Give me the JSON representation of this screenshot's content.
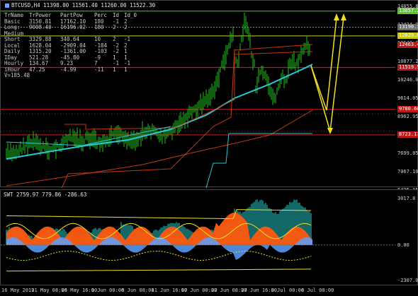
{
  "main": {
    "title": "BTCUSD,H4  11398.00 11561.40 11260.00 11522.30",
    "stats": {
      "headers": [
        "TrName",
        "TrPower",
        "PartPow",
        "Perc",
        "Id",
        "Id_0"
      ],
      "rows": [
        [
          "Basic",
          "3150.81",
          "17162.10",
          "180",
          "-1",
          "2"
        ],
        [
          "Long:",
          "9008.40",
          "16196.02",
          "180",
          "2",
          "2"
        ],
        [
          "Medium",
          "",
          "",
          "",
          "",
          ""
        ],
        [
          "Short",
          "3329.88",
          "340.64",
          "10",
          "2",
          "-1"
        ],
        [
          "Local",
          "1628.04",
          "-2909.04",
          "-184",
          "-2",
          "2"
        ],
        [
          "Daily",
          "1315.20",
          "-1361.00",
          "-103",
          "-2",
          "1"
        ],
        [
          "IDay",
          "521.28",
          "-45.80",
          "-9",
          "1",
          "1"
        ],
        [
          "Hourly",
          "134.67",
          "9.23",
          "7",
          "-1",
          "-1"
        ],
        [
          "iHour",
          "47.25",
          "-4.99",
          "-11",
          "1",
          "1"
        ]
      ],
      "footer": "V=185.48"
    },
    "price_labels": [
      {
        "text": "13857.20",
        "color": "#55c82a",
        "price": 13857.2
      },
      {
        "text": "13190.30",
        "color": "#6e6e6e",
        "price": 13190.3
      },
      {
        "text": "12829.87",
        "color": "#c8c81a",
        "price": 12829.87
      },
      {
        "text": "12463.46",
        "color": "#c01818",
        "price": 12463.46
      },
      {
        "text": "11519.50",
        "color": "#c01818",
        "price": 11519.5
      },
      {
        "text": "9780.60",
        "color": "#c01818",
        "price": 9780.6
      },
      {
        "text": "8723.17",
        "color": "#c01818",
        "price": 8723.17
      }
    ],
    "axis_labels": [
      "14055.85",
      "13424.90",
      "12141.95",
      "10877.20",
      "10246.00",
      "9614.05",
      "8962.95",
      "8331.00",
      "7699.05",
      "7067.10",
      "6435.15"
    ]
  },
  "indicator": {
    "title": "SWT 2759.97 779.86 -286.63",
    "axis_labels": [
      {
        "text": "3017.8",
        "value": 3017.8
      },
      {
        "text": "0.00",
        "value": 0
      },
      {
        "text": "-2307.08",
        "value": -2307.08
      }
    ]
  },
  "time_labels": [
    "16 May 2019",
    "21 May 08:00",
    "26 May 16:00",
    "1 Jun 00:00",
    "6 Jun 08:00",
    "11 Jun 16:00",
    "17 Jun 00:00",
    "22 Jun 08:00",
    "27 Jun 16:00",
    "3 Jul 00:00",
    "8 Jul 08:00"
  ],
  "colors": {
    "candle": "#1fbf1f",
    "ma_fast": "#2ac8d8",
    "ma_slow": "#c03810",
    "forecast": "#f0e020",
    "histo_teal": "#1a8a8a",
    "histo_orange": "#ff5a10",
    "histo_blue": "#5aa0ff"
  }
}
